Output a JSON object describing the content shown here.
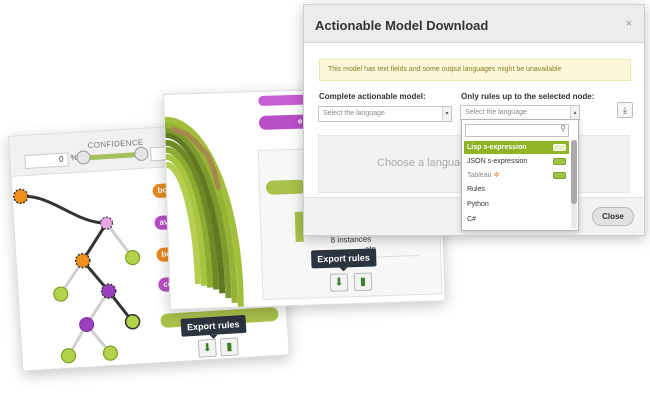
{
  "card1": {
    "confidence_label": "CONFIDENCE",
    "conf_min": "0",
    "conf_unit": "%",
    "conf_max": "10",
    "pills": [
      "bo",
      "av",
      "bo",
      "co"
    ],
    "tooltip": "Export rules"
  },
  "card2": {
    "pill_label": "e",
    "instances": "8 instances",
    "data_partial": "ata",
    "tooltip": "Export rules"
  },
  "dialog": {
    "title": "Actionable Model Download",
    "close_symbol": "×",
    "notice": "This model has text fields and some output languages might be unavailable",
    "complete_label": "Complete actionable model:",
    "complete_placeholder": "Select the language",
    "rules_label": "Only rules up to the selected node:",
    "rules_placeholder": "Select the language",
    "choose_text": "Choose a language",
    "close_button": "Close",
    "languages": [
      {
        "name": "Lisp s-expression",
        "active": true
      },
      {
        "name": "JSON s-expression",
        "active": false
      },
      {
        "name": "Tableau",
        "active": false
      },
      {
        "name": "Rules",
        "active": false
      },
      {
        "name": "Python",
        "active": false
      },
      {
        "name": "C#",
        "active": false
      }
    ]
  },
  "colors": {
    "accent_green": "#8fb527",
    "pill_orange": "#e8891e",
    "pill_purple": "#b94fc6",
    "node_purple": "#9a3fc0",
    "node_green": "#b5d34a",
    "node_orange": "#ef8f1c",
    "tooltip_dark": "#2c3440"
  },
  "icons": {
    "export": "cloud-download-icon",
    "chart": "bar-chart-plus-icon",
    "search": "search-icon",
    "download": "download-icon"
  }
}
